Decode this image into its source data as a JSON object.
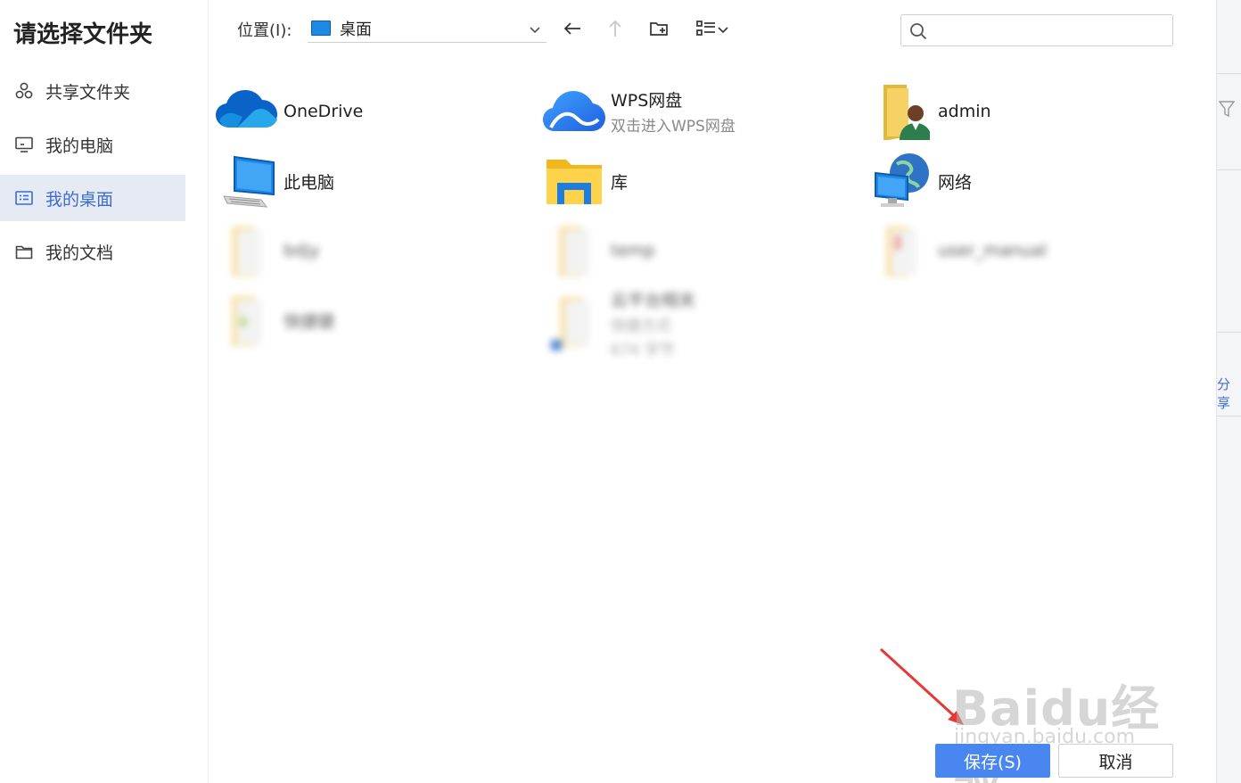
{
  "dialog": {
    "title": "请选择文件夹"
  },
  "sidebar": {
    "items": [
      {
        "label": "共享文件夹",
        "icon": "share-icon"
      },
      {
        "label": "我的电脑",
        "icon": "monitor-icon"
      },
      {
        "label": "我的桌面",
        "icon": "desktop-icon",
        "active": true
      },
      {
        "label": "我的文档",
        "icon": "folder-outline-icon"
      }
    ]
  },
  "toolbar": {
    "location_label": "位置(I):",
    "location_value": "桌面",
    "search_placeholder": ""
  },
  "items": [
    {
      "name": "OneDrive",
      "icon": "onedrive-cloud-icon"
    },
    {
      "name": "WPS网盘",
      "sub": "双击进入WPS网盘",
      "icon": "wps-cloud-icon"
    },
    {
      "name": "admin",
      "icon": "user-folder-icon"
    },
    {
      "name": "此电脑",
      "icon": "computer-icon"
    },
    {
      "name": "库",
      "icon": "library-folder-icon"
    },
    {
      "name": "网络",
      "icon": "network-globe-icon"
    },
    {
      "name": "bdjy",
      "icon": "folder-icon",
      "blurred": true
    },
    {
      "name": "temp",
      "icon": "folder-icon",
      "blurred": true
    },
    {
      "name": "user_manual",
      "icon": "folder-icon",
      "blurred": true
    },
    {
      "name": "快捷键",
      "icon": "folder-icon",
      "blurred": true
    },
    {
      "name": "云平台相关",
      "sub": "快捷方式",
      "sub2": "674 字节",
      "icon": "shortcut-folder-icon",
      "blurred": true
    }
  ],
  "right_strip": {
    "share_label": "分享"
  },
  "footer": {
    "save_label": "保存(S)",
    "cancel_label": "取消"
  },
  "watermark": {
    "main": "Baidu经验",
    "sub": "jingyan.baidu.com"
  },
  "colors": {
    "accent": "#4a86f0",
    "active_bg": "#e6eaf3",
    "active_text": "#3d6bd6",
    "annotation_arrow": "#e53935"
  }
}
